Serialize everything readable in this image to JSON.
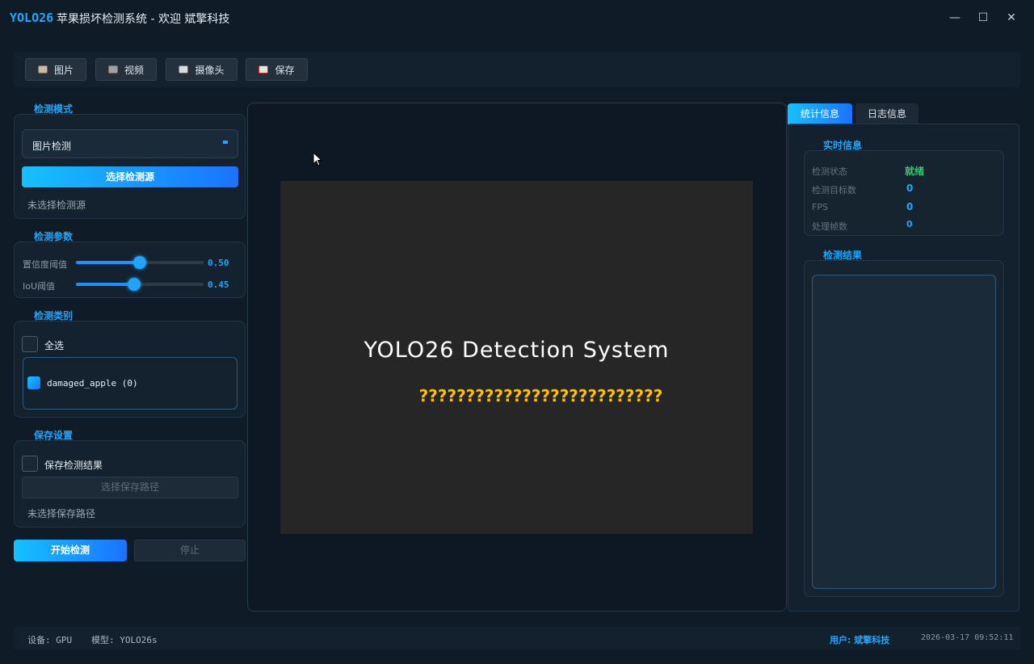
{
  "window": {
    "app_name": "YOLO26",
    "title": "苹果损坏检测系统 - 欢迎 斌擎科技",
    "minimize": "—",
    "maximize": "☐",
    "close": "✕"
  },
  "toolbar": {
    "image": "图片",
    "video": "视频",
    "camera": "摄像头",
    "save": "保存"
  },
  "mode": {
    "title": "检测模式",
    "selected": "图片检测",
    "select_source": "选择检测源",
    "source_status": "未选择检测源"
  },
  "params": {
    "title": "检测参数",
    "confidence_label": "置信度阈值",
    "confidence": "0.50",
    "confidence_value": 0.5,
    "iou_label": "IoU阈值",
    "iou": "0.45",
    "iou_value": 0.45
  },
  "classes": {
    "title": "检测类别",
    "select_all": "全选",
    "items": [
      "damaged_apple (0)"
    ]
  },
  "save_settings": {
    "title": "保存设置",
    "save_results": "保存检测结果",
    "choose_path": "选择保存路径",
    "path_status": "未选择保存路径"
  },
  "actions": {
    "start": "开始检测",
    "stop": "停止"
  },
  "display": {
    "title": "YOLO26 Detection System",
    "subtitle": "??????????????????????????"
  },
  "tabs": {
    "stats": "统计信息",
    "log": "日志信息"
  },
  "realtime": {
    "title": "实时信息",
    "status_label": "检测状态",
    "status": "就绪",
    "targets_label": "检测目标数",
    "targets": "0",
    "fps_label": "FPS",
    "fps": "0",
    "frames_label": "处理帧数",
    "frames": "0"
  },
  "results": {
    "title": "检测结果"
  },
  "statusbar": {
    "device": "设备: GPU",
    "model": "模型: YOLO26s",
    "user": "用户: 斌擎科技",
    "datetime": "2026-03-17 09:52:11"
  },
  "colors": {
    "accent": "#1ea7ff",
    "status_ready": "#2ecc71",
    "subtitle": "#ffc000"
  }
}
